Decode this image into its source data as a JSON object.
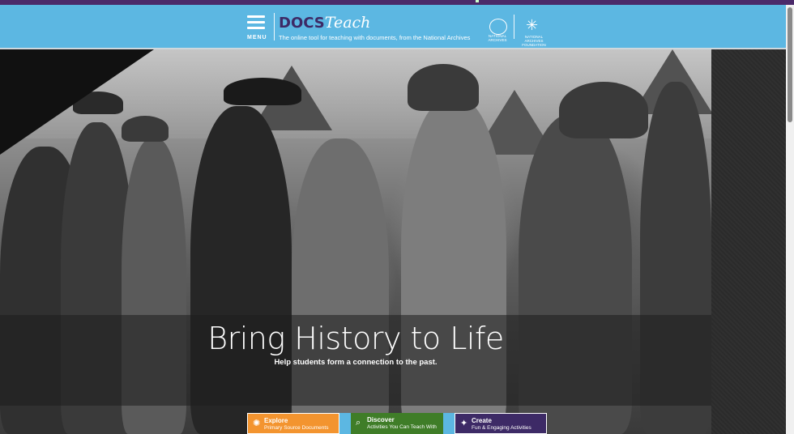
{
  "brand": {
    "docs": "DOCS",
    "teach": "Teach",
    "tagline": "The online tool for teaching with documents, from the National Archives",
    "colors": {
      "purple": "#3d2a66",
      "header_blue": "#5cb7e2",
      "explore_orange": "#f3942f",
      "discover_green": "#3f7d28"
    }
  },
  "header": {
    "menu_label": "MENU",
    "national_archives": "NATIONAL ARCHIVES",
    "na_foundation": "NATIONAL ARCHIVES FOUNDATION"
  },
  "hero": {
    "title": "Bring History to Life",
    "subtitle": "Help students form a connection to the past."
  },
  "cta": {
    "explore": {
      "title": "Explore",
      "subtitle": "Primary Source Documents",
      "icon": "compass-icon"
    },
    "discover": {
      "title": "Discover",
      "subtitle": "Activities You Can Teach With",
      "icon": "search-icon"
    },
    "create": {
      "title": "Create",
      "subtitle": "Fun & Engaging Activities",
      "icon": "magic-wand-icon"
    }
  }
}
